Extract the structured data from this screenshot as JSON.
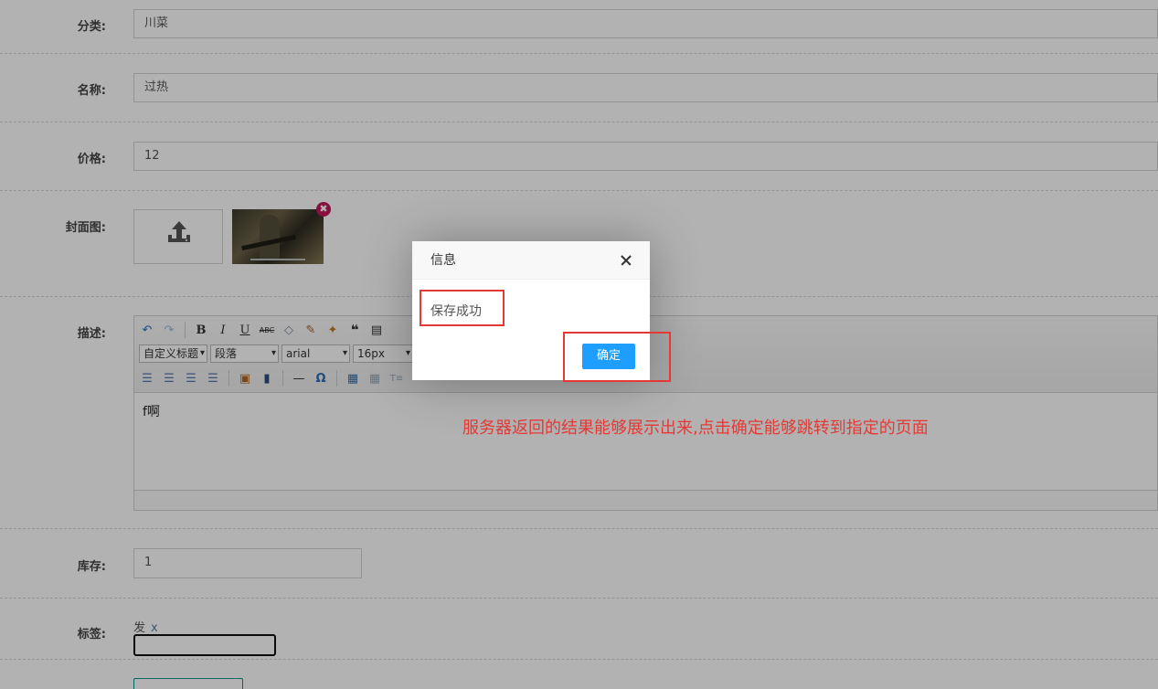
{
  "form": {
    "category": {
      "label": "分类:",
      "value": "川菜"
    },
    "name": {
      "label": "名称:",
      "value": "过热"
    },
    "price": {
      "label": "价格:",
      "value": "12"
    },
    "cover": {
      "label": "封面图:",
      "delete_glyph": "✖"
    },
    "description": {
      "label": "描述:",
      "heading_select": "自定义标题",
      "paragraph_select": "段落",
      "font_select": "arial",
      "size_select": "16px",
      "content": "f啊"
    },
    "stock": {
      "label": "库存:",
      "value": "1"
    },
    "tags": {
      "label": "标签:",
      "items": [
        {
          "text": "发",
          "remove": "x"
        }
      ]
    }
  },
  "dialog": {
    "title": "信息",
    "message": "保存成功",
    "confirm_label": "确定"
  },
  "annotation": {
    "text": "服务器返回的结果能够展示出来,点击确定能够跳转到指定的页面",
    "color": "#e53935"
  },
  "colors": {
    "primary_button": "#1e9fff",
    "highlight": "#e53935",
    "tag_remove": "#5b7fa5"
  }
}
